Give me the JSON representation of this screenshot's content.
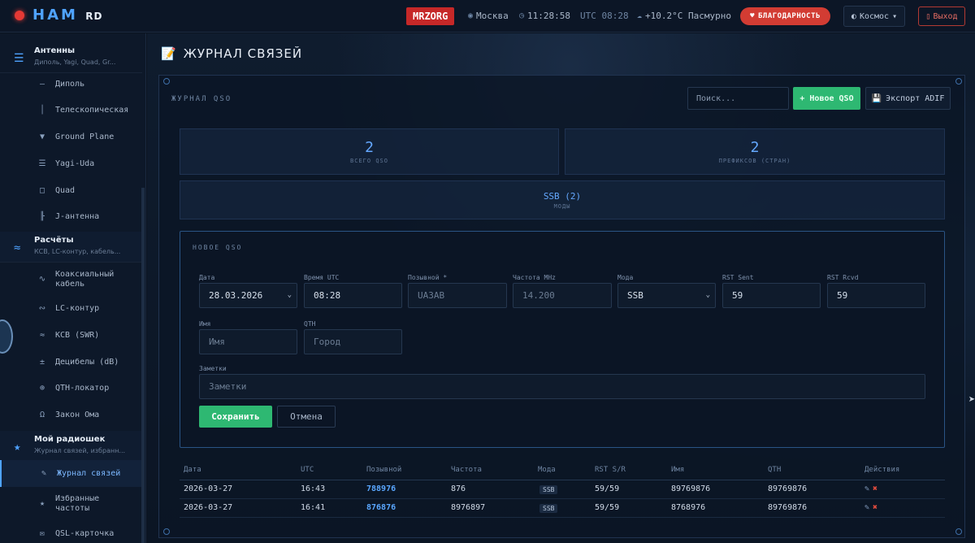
{
  "app": {
    "logo_main": "HAM",
    "logo_sub": "RD",
    "callsign": "MRZORG"
  },
  "topbar": {
    "location": "Москва",
    "time_local": "11:28:58",
    "time_utc": "UTC 08:28",
    "weather": "+10.2°C Пасмурно",
    "thanks_label": "БЛАГОДАРНОСТЬ",
    "theme_label": "Космос",
    "logout_label": "Выход"
  },
  "sidebar": {
    "groups": [
      {
        "title": "Антенны",
        "subtitle": "Диполь, Yagi, Quad, Gr...",
        "icon": "hamburger-icon"
      },
      {
        "title": "Расчёты",
        "subtitle": "КСВ, LC-контур, кабель...",
        "icon": "approx-icon"
      },
      {
        "title": "Мой радиошек",
        "subtitle": "Журнал связей, избранн...",
        "icon": "star-icon"
      }
    ],
    "antenna_items": [
      {
        "label": "Диполь",
        "icon": "dipole-icon"
      },
      {
        "label": "Телескопическая",
        "icon": "telescopic-icon"
      },
      {
        "label": "Ground Plane",
        "icon": "ground-plane-icon"
      },
      {
        "label": "Yagi-Uda",
        "icon": "yagi-icon"
      },
      {
        "label": "Quad",
        "icon": "quad-icon"
      },
      {
        "label": "J-антенна",
        "icon": "j-antenna-icon"
      }
    ],
    "calc_items": [
      {
        "label": "Коаксиальный кабель",
        "icon": "coax-icon"
      },
      {
        "label": "LC-контур",
        "icon": "lc-icon"
      },
      {
        "label": "КСВ (SWR)",
        "icon": "swr-icon"
      },
      {
        "label": "Децибелы (dB)",
        "icon": "db-icon"
      },
      {
        "label": "QTH-локатор",
        "icon": "locator-icon"
      },
      {
        "label": "Закон Ома",
        "icon": "ohm-icon"
      }
    ],
    "shack_items": [
      {
        "label": "Журнал связей",
        "icon": "log-icon",
        "active": true
      },
      {
        "label": "Избранные частоты",
        "icon": "star-icon"
      },
      {
        "label": "QSL-карточка",
        "icon": "mail-icon"
      }
    ]
  },
  "page": {
    "title": "ЖУРНАЛ СВЯЗЕЙ"
  },
  "log_panel": {
    "title": "ЖУРНАЛ QSO",
    "search_placeholder": "Поиск...",
    "new_qso_label": "+ Новое QSO",
    "export_label": "Экспорт ADIF"
  },
  "stats": {
    "total": {
      "value": "2",
      "label": "ВСЕГО QSO"
    },
    "prefixes": {
      "value": "2",
      "label": "ПРЕФИКСОВ (СТРАН)"
    },
    "modes": {
      "value": "SSB (2)",
      "label": "МОДЫ"
    }
  },
  "form": {
    "title": "НОВОЕ QSO",
    "fields": {
      "date": {
        "label": "Дата",
        "value": "28.03.2026"
      },
      "time": {
        "label": "Время UTC",
        "value": "08:28"
      },
      "callsign": {
        "label": "Позывной *",
        "placeholder": "UA3AB"
      },
      "freq": {
        "label": "Частота MHz",
        "placeholder": "14.200"
      },
      "mode": {
        "label": "Мода",
        "value": "SSB"
      },
      "rst_sent": {
        "label": "RST Sent",
        "value": "59"
      },
      "rst_rcvd": {
        "label": "RST Rcvd",
        "value": "59"
      },
      "name": {
        "label": "Имя",
        "placeholder": "Имя"
      },
      "qth": {
        "label": "QTH",
        "placeholder": "Город"
      },
      "notes": {
        "label": "Заметки",
        "placeholder": "Заметки"
      }
    },
    "save_label": "Сохранить",
    "cancel_label": "Отмена"
  },
  "table": {
    "headers": [
      "Дата",
      "UTC",
      "Позывной",
      "Частота",
      "Мода",
      "RST S/R",
      "Имя",
      "QTH",
      "Действия"
    ],
    "rows": [
      {
        "date": "2026-03-27",
        "utc": "16:43",
        "call": "788976",
        "freq": "876",
        "mode": "SSB",
        "rst": "59/59",
        "name": "89769876",
        "qth": "89769876"
      },
      {
        "date": "2026-03-27",
        "utc": "16:41",
        "call": "876876",
        "freq": "8976897",
        "mode": "SSB",
        "rst": "59/59",
        "name": "8768976",
        "qth": "89769876"
      }
    ]
  },
  "colors": {
    "accent": "#4fa3ff",
    "primary_green": "#2eb872",
    "danger": "#d23c33",
    "callsign_bg": "#c62828"
  }
}
